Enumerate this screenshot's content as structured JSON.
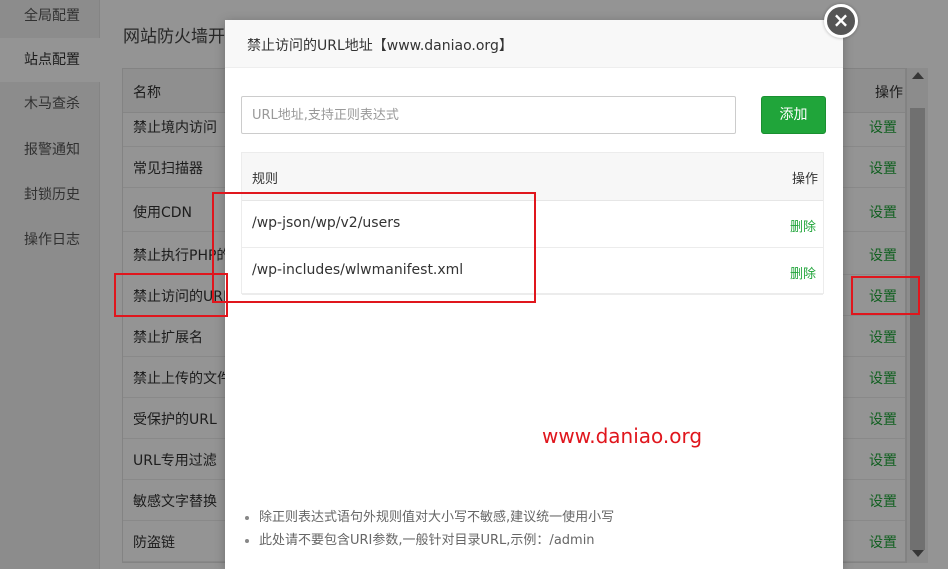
{
  "sidebar": {
    "items": [
      {
        "label": "全局配置"
      },
      {
        "label": "站点配置"
      },
      {
        "label": "木马查杀"
      },
      {
        "label": "报警通知"
      },
      {
        "label": "封锁历史"
      },
      {
        "label": "操作日志"
      }
    ]
  },
  "main": {
    "title": "网站防火墙开",
    "table": {
      "header_name": "名称",
      "header_op": "操作",
      "rows": [
        {
          "name": "禁止境内访问",
          "op": "设置"
        },
        {
          "name": "常见扫描器",
          "op": "设置"
        },
        {
          "name": "使用CDN",
          "op": "设置"
        },
        {
          "name": "禁止执行PHP的",
          "op": "设置"
        },
        {
          "name": "禁止访问的URL",
          "op": "设置"
        },
        {
          "name": "禁止扩展名",
          "op": "设置"
        },
        {
          "name": "禁止上传的文件",
          "op": "设置"
        },
        {
          "name": "受保护的URL",
          "op": "设置"
        },
        {
          "name": "URL专用过滤",
          "op": "设置"
        },
        {
          "name": "敏感文字替换",
          "op": "设置"
        },
        {
          "name": "防盗链",
          "op": "设置"
        }
      ]
    }
  },
  "modal": {
    "title": "禁止访问的URL地址【www.daniao.org】",
    "close_icon": "×",
    "input_placeholder": "URL地址,支持正则表达式",
    "input_value": "",
    "add_label": "添加",
    "rules_header_label": "规则",
    "rules_header_op": "操作",
    "rules": [
      {
        "rule": "/wp-json/wp/v2/users",
        "op": "删除"
      },
      {
        "rule": "/wp-includes/wlwmanifest.xml",
        "op": "删除"
      }
    ],
    "watermark": "www.daniao.org",
    "notes": [
      "除正则表达式语句外规则值对大小写不敏感,建议统一使用小写",
      "此处请不要包含URI参数,一般针对目录URL,示例：/admin"
    ]
  },
  "colors": {
    "accent_green": "#20a53a",
    "highlight_red": "#e0161d"
  }
}
